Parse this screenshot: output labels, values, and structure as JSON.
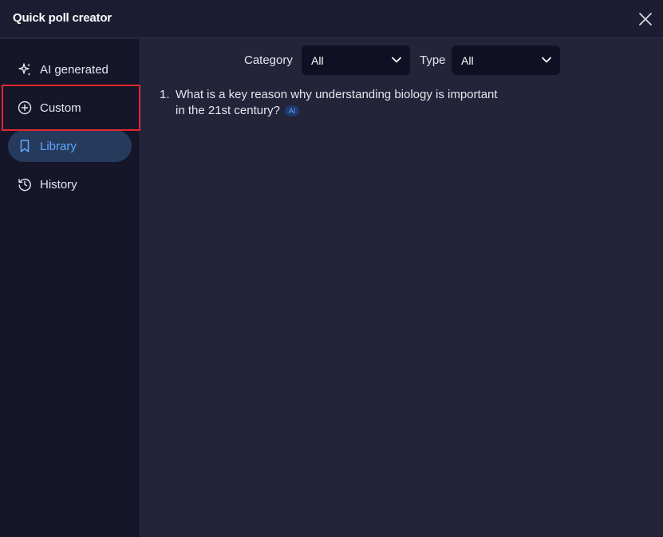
{
  "window": {
    "title": "Quick poll creator"
  },
  "sidebar": {
    "items": [
      {
        "label": "AI generated",
        "icon": "sparkles-icon"
      },
      {
        "label": "Custom",
        "icon": "plus-circle-icon"
      },
      {
        "label": "Library",
        "icon": "bookmark-icon",
        "active": true
      },
      {
        "label": "History",
        "icon": "history-icon"
      }
    ]
  },
  "filters": {
    "category_label": "Category",
    "category_value": "All",
    "type_label": "Type",
    "type_value": "All"
  },
  "questions": [
    {
      "number": "1.",
      "text_line1": "What is a key reason why understanding biology is important",
      "text_line2": "in the 21st century?",
      "badge": "AI"
    }
  ],
  "colors": {
    "accent": "#5fa8ff",
    "active_bg": "#263a5c",
    "highlight": "#e0282e"
  }
}
